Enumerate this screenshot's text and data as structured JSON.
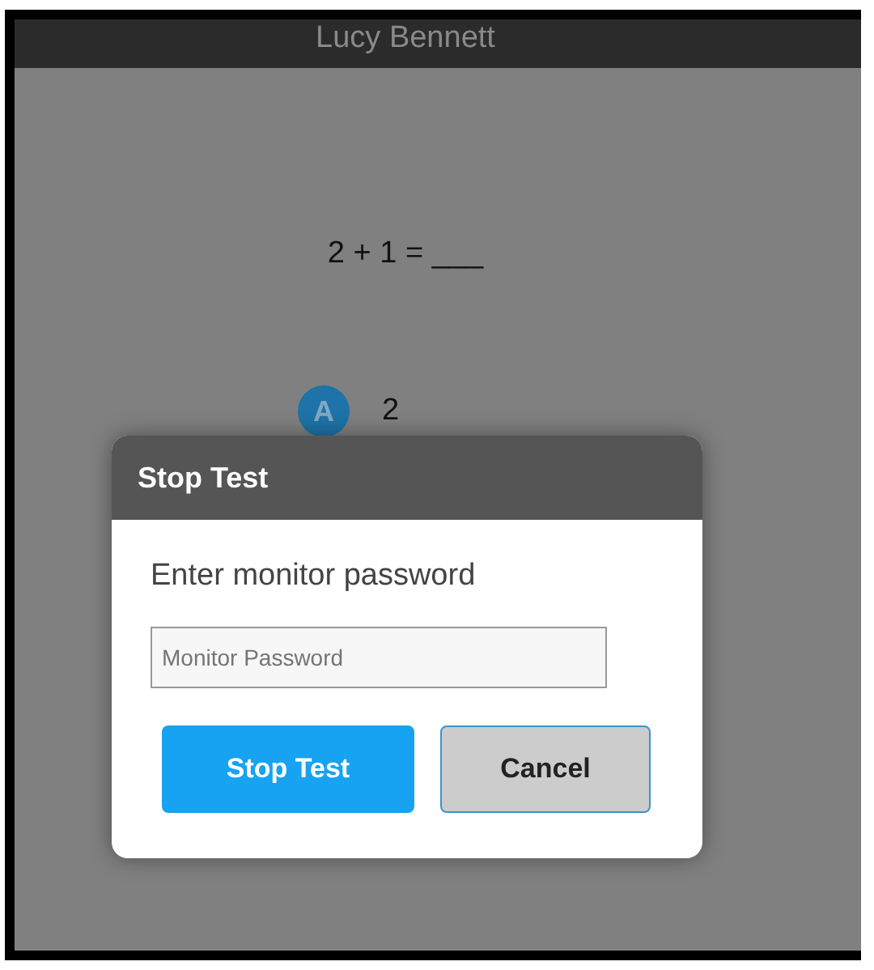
{
  "header": {
    "student_name": "Lucy Bennett"
  },
  "question": {
    "text": "2 + 1 = ___"
  },
  "options": [
    {
      "letter": "A",
      "text": "2"
    }
  ],
  "dialog": {
    "title": "Stop Test",
    "prompt": "Enter monitor password",
    "password_field": {
      "placeholder": "Monitor Password"
    },
    "buttons": [
      {
        "label": "Stop Test",
        "kind": "primary"
      },
      {
        "label": "Cancel",
        "kind": "secondary"
      }
    ]
  }
}
